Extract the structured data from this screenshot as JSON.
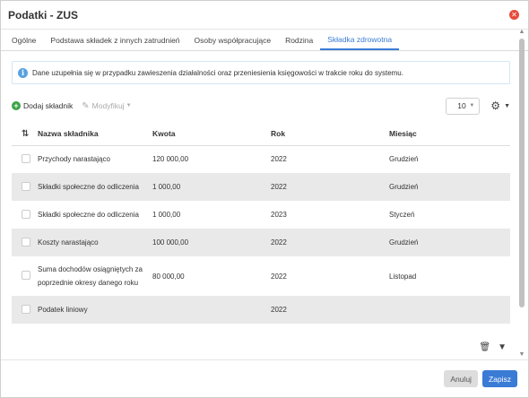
{
  "window": {
    "title": "Podatki - ZUS"
  },
  "tabs": [
    {
      "label": "Ogólne",
      "active": false
    },
    {
      "label": "Podstawa składek z innych zatrudnień",
      "active": false
    },
    {
      "label": "Osoby współpracujące",
      "active": false
    },
    {
      "label": "Rodzina",
      "active": false
    },
    {
      "label": "Składka zdrowotna",
      "active": true
    }
  ],
  "info": {
    "text": "Dane uzupełnia się w przypadku zawieszenia działalności oraz przeniesienia księgowości w trakcie roku do systemu."
  },
  "toolbar": {
    "add_label": "Dodaj składnik",
    "edit_label": "Modyfikuj",
    "page_size": "10",
    "settings_icon": "gears-icon"
  },
  "table": {
    "headers": {
      "name": "Nazwa składnika",
      "kwota": "Kwota",
      "rok": "Rok",
      "miesiac": "Miesiąc"
    },
    "rows": [
      {
        "name": "Przychody narastająco",
        "kwota": "120 000,00",
        "rok": "2022",
        "miesiac": "Grudzień"
      },
      {
        "name": "Składki społeczne do odliczenia",
        "kwota": "1 000,00",
        "rok": "2022",
        "miesiac": "Grudzień"
      },
      {
        "name": "Składki społeczne do odliczenia",
        "kwota": "1 000,00",
        "rok": "2023",
        "miesiac": "Styczeń"
      },
      {
        "name": "Koszty narastająco",
        "kwota": "100 000,00",
        "rok": "2022",
        "miesiac": "Grudzień"
      },
      {
        "name": "Suma dochodów osiągniętych za poprzednie okresy danego roku",
        "kwota": "80 000,00",
        "rok": "2022",
        "miesiac": "Listopad"
      },
      {
        "name": "Podatek liniowy",
        "kwota": "",
        "rok": "2022",
        "miesiac": ""
      }
    ]
  },
  "footer": {
    "cancel_label": "Anuluj",
    "save_label": "Zapisz"
  },
  "colors": {
    "accent": "#3a7bd5",
    "close": "#e74c3c",
    "add": "#3aa346",
    "info": "#5aa1e0"
  }
}
